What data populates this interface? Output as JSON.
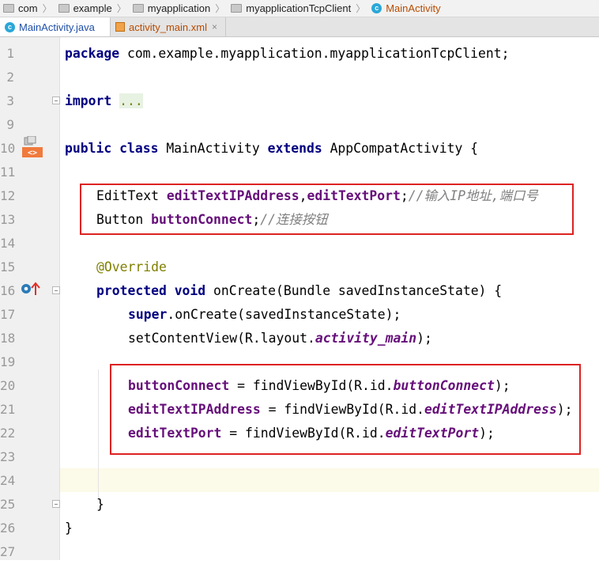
{
  "breadcrumb": {
    "items": [
      {
        "label": "com",
        "icon": "folder-icon"
      },
      {
        "label": "example",
        "icon": "folder-icon"
      },
      {
        "label": "myapplication",
        "icon": "folder-icon"
      },
      {
        "label": "myapplicationTcpClient",
        "icon": "folder-icon"
      },
      {
        "label": "MainActivity",
        "icon": "class-icon"
      }
    ]
  },
  "tabs": [
    {
      "label": "MainActivity.java",
      "active": true,
      "icon": "class-icon"
    },
    {
      "label": "activity_main.xml",
      "active": false,
      "icon": "xml-icon"
    }
  ],
  "icons": {
    "class_letter": "c",
    "close_glyph": "×"
  },
  "gutter": {
    "line_numbers": [
      "1",
      "2",
      "3",
      "9",
      "10",
      "11",
      "12",
      "13",
      "14",
      "15",
      "16",
      "17",
      "18",
      "19",
      "20",
      "21",
      "22",
      "23",
      "24",
      "25",
      "26",
      "27"
    ]
  },
  "code": {
    "l1_kw": "package",
    "l1_rest": " com.example.myapplication.myapplicationTcpClient;",
    "l3_kw": "import",
    "l3_folded": "...",
    "l10_kw1": "public",
    "l10_kw2": "class",
    "l10_name": "MainActivity",
    "l10_kw3": "extends",
    "l10_rest": "AppCompatActivity {",
    "l12_type": "EditText",
    "l12_f1": "editTextIPAddress",
    "l12_comma": ",",
    "l12_f2": "editTextPort",
    "l12_semi": ";",
    "l12_comment": "//输入IP地址,端口号",
    "l13_type": "Button",
    "l13_f1": "buttonConnect",
    "l13_semi": ";",
    "l13_comment": "//连接按钮",
    "l15_annotation": "@Override",
    "l16_kw1": "protected",
    "l16_kw2": "void",
    "l16_rest": "onCreate(Bundle savedInstanceState) {",
    "l17_kw": "super",
    "l17_rest": ".onCreate(savedInstanceState);",
    "l18_pre": "setContentView(R.layout.",
    "l18_field": "activity_main",
    "l18_post": ");",
    "l20_f": "buttonConnect",
    "l20_mid": " = findViewById(R.id.",
    "l20_field": "buttonConnect",
    "l20_post": ");",
    "l21_f": "editTextIPAddress",
    "l21_mid": " = findViewById(R.id.",
    "l21_field": "editTextIPAddress",
    "l21_post": ");",
    "l22_f": "editTextPort",
    "l22_mid": " = findViewById(R.id.",
    "l22_field": "editTextPort",
    "l22_post": ");",
    "l25": "}",
    "l26": "}"
  },
  "colors": {
    "keyword": "#000080",
    "field": "#660e7a",
    "comment": "#808080",
    "annotation": "#808000",
    "highlight_box": "#dd2222"
  }
}
